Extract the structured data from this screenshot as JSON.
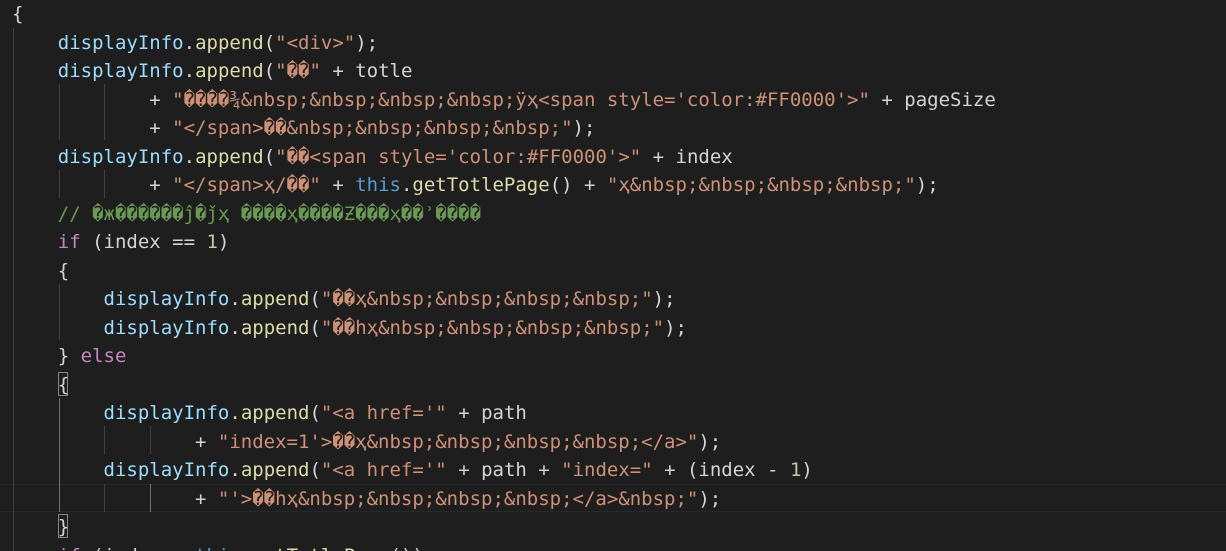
{
  "editor": {
    "language": "javascript",
    "colors": {
      "background": "#1e1e1e",
      "plain": "#d4d4d4",
      "variable": "#9cdcfe",
      "function": "#dcdcaa",
      "string": "#ce9178",
      "keyword": "#c586c0",
      "this": "#569cd6",
      "number": "#b5cea8",
      "comment": "#6a9955"
    },
    "lines": [
      {
        "tokens": [
          {
            "t": "plain",
            "s": "{"
          }
        ]
      },
      {
        "tokens": [
          {
            "t": "plain",
            "s": "    "
          },
          {
            "t": "var",
            "s": "displayInfo"
          },
          {
            "t": "plain",
            "s": "."
          },
          {
            "t": "fn",
            "s": "append"
          },
          {
            "t": "plain",
            "s": "("
          },
          {
            "t": "str",
            "s": "\"<div>\""
          },
          {
            "t": "plain",
            "s": ");"
          }
        ]
      },
      {
        "tokens": [
          {
            "t": "plain",
            "s": "    "
          },
          {
            "t": "var",
            "s": "displayInfo"
          },
          {
            "t": "plain",
            "s": "."
          },
          {
            "t": "fn",
            "s": "append"
          },
          {
            "t": "plain",
            "s": "("
          },
          {
            "t": "str",
            "s": "\"��\""
          },
          {
            "t": "plain",
            "s": " + totle"
          }
        ]
      },
      {
        "tokens": [
          {
            "t": "plain",
            "s": "            + "
          },
          {
            "t": "str",
            "s": "\"����¾&nbsp;&nbsp;&nbsp;&nbsp;ÿҳ<span style='color:#FF0000'>\""
          },
          {
            "t": "plain",
            "s": " + pageSize"
          }
        ]
      },
      {
        "tokens": [
          {
            "t": "plain",
            "s": "            + "
          },
          {
            "t": "str",
            "s": "\"</span>��&nbsp;&nbsp;&nbsp;&nbsp;\""
          },
          {
            "t": "plain",
            "s": ");"
          }
        ]
      },
      {
        "tokens": [
          {
            "t": "plain",
            "s": "    "
          },
          {
            "t": "var",
            "s": "displayInfo"
          },
          {
            "t": "plain",
            "s": "."
          },
          {
            "t": "fn",
            "s": "append"
          },
          {
            "t": "plain",
            "s": "("
          },
          {
            "t": "str",
            "s": "\"��<span style='color:#FF0000'>\""
          },
          {
            "t": "plain",
            "s": " + index"
          }
        ]
      },
      {
        "tokens": [
          {
            "t": "plain",
            "s": "            + "
          },
          {
            "t": "str",
            "s": "\"</span>ҳ/��\""
          },
          {
            "t": "plain",
            "s": " + "
          },
          {
            "t": "this",
            "s": "this"
          },
          {
            "t": "plain",
            "s": "."
          },
          {
            "t": "fn",
            "s": "getTotlePage"
          },
          {
            "t": "plain",
            "s": "() + "
          },
          {
            "t": "str",
            "s": "\"ҳ&nbsp;&nbsp;&nbsp;&nbsp;\""
          },
          {
            "t": "plain",
            "s": ");"
          }
        ]
      },
      {
        "tokens": [
          {
            "t": "plain",
            "s": "    "
          },
          {
            "t": "com",
            "s": "// �ж������ĵ�ǰҳ ����ҳ����Ƶ���ҳ��ʾ����"
          }
        ]
      },
      {
        "tokens": [
          {
            "t": "plain",
            "s": "    "
          },
          {
            "t": "kw",
            "s": "if"
          },
          {
            "t": "plain",
            "s": " (index == "
          },
          {
            "t": "num",
            "s": "1"
          },
          {
            "t": "plain",
            "s": ")"
          }
        ]
      },
      {
        "tokens": [
          {
            "t": "plain",
            "s": "    {"
          }
        ]
      },
      {
        "tokens": [
          {
            "t": "plain",
            "s": "        "
          },
          {
            "t": "var",
            "s": "displayInfo"
          },
          {
            "t": "plain",
            "s": "."
          },
          {
            "t": "fn",
            "s": "append"
          },
          {
            "t": "plain",
            "s": "("
          },
          {
            "t": "str",
            "s": "\"��ҳ&nbsp;&nbsp;&nbsp;&nbsp;\""
          },
          {
            "t": "plain",
            "s": ");"
          }
        ]
      },
      {
        "tokens": [
          {
            "t": "plain",
            "s": "        "
          },
          {
            "t": "var",
            "s": "displayInfo"
          },
          {
            "t": "plain",
            "s": "."
          },
          {
            "t": "fn",
            "s": "append"
          },
          {
            "t": "plain",
            "s": "("
          },
          {
            "t": "str",
            "s": "\"��һҳ&nbsp;&nbsp;&nbsp;&nbsp;\""
          },
          {
            "t": "plain",
            "s": ");"
          }
        ]
      },
      {
        "tokens": [
          {
            "t": "plain",
            "s": "    } "
          },
          {
            "t": "kw",
            "s": "else"
          }
        ]
      },
      {
        "tokens": [
          {
            "t": "plain",
            "s": "    {"
          }
        ]
      },
      {
        "tokens": [
          {
            "t": "plain",
            "s": "        "
          },
          {
            "t": "var",
            "s": "displayInfo"
          },
          {
            "t": "plain",
            "s": "."
          },
          {
            "t": "fn",
            "s": "append"
          },
          {
            "t": "plain",
            "s": "("
          },
          {
            "t": "str",
            "s": "\"<a href='\""
          },
          {
            "t": "plain",
            "s": " + path"
          }
        ]
      },
      {
        "tokens": [
          {
            "t": "plain",
            "s": "                + "
          },
          {
            "t": "str",
            "s": "\"index=1'>��ҳ&nbsp;&nbsp;&nbsp;&nbsp;</a>\""
          },
          {
            "t": "plain",
            "s": ");"
          }
        ]
      },
      {
        "tokens": [
          {
            "t": "plain",
            "s": "        "
          },
          {
            "t": "var",
            "s": "displayInfo"
          },
          {
            "t": "plain",
            "s": "."
          },
          {
            "t": "fn",
            "s": "append"
          },
          {
            "t": "plain",
            "s": "("
          },
          {
            "t": "str",
            "s": "\"<a href='\""
          },
          {
            "t": "plain",
            "s": " + path + "
          },
          {
            "t": "str",
            "s": "\"index=\""
          },
          {
            "t": "plain",
            "s": " + (index - "
          },
          {
            "t": "num",
            "s": "1"
          },
          {
            "t": "plain",
            "s": ")"
          }
        ]
      },
      {
        "tokens": [
          {
            "t": "plain",
            "s": "                + "
          },
          {
            "t": "str",
            "s": "\"'>��һҳ&nbsp;&nbsp;&nbsp;&nbsp;</a>&nbsp;\""
          },
          {
            "t": "plain",
            "s": ");"
          }
        ]
      },
      {
        "tokens": [
          {
            "t": "plain",
            "s": "    }"
          }
        ]
      },
      {
        "tokens": [
          {
            "t": "plain",
            "s": "    "
          },
          {
            "t": "kw",
            "s": "if"
          },
          {
            "t": "plain",
            "s": " (index < "
          },
          {
            "t": "this",
            "s": "this"
          },
          {
            "t": "plain",
            "s": "."
          },
          {
            "t": "fn",
            "s": "getTotlePage"
          },
          {
            "t": "plain",
            "s": "())"
          }
        ]
      }
    ]
  }
}
